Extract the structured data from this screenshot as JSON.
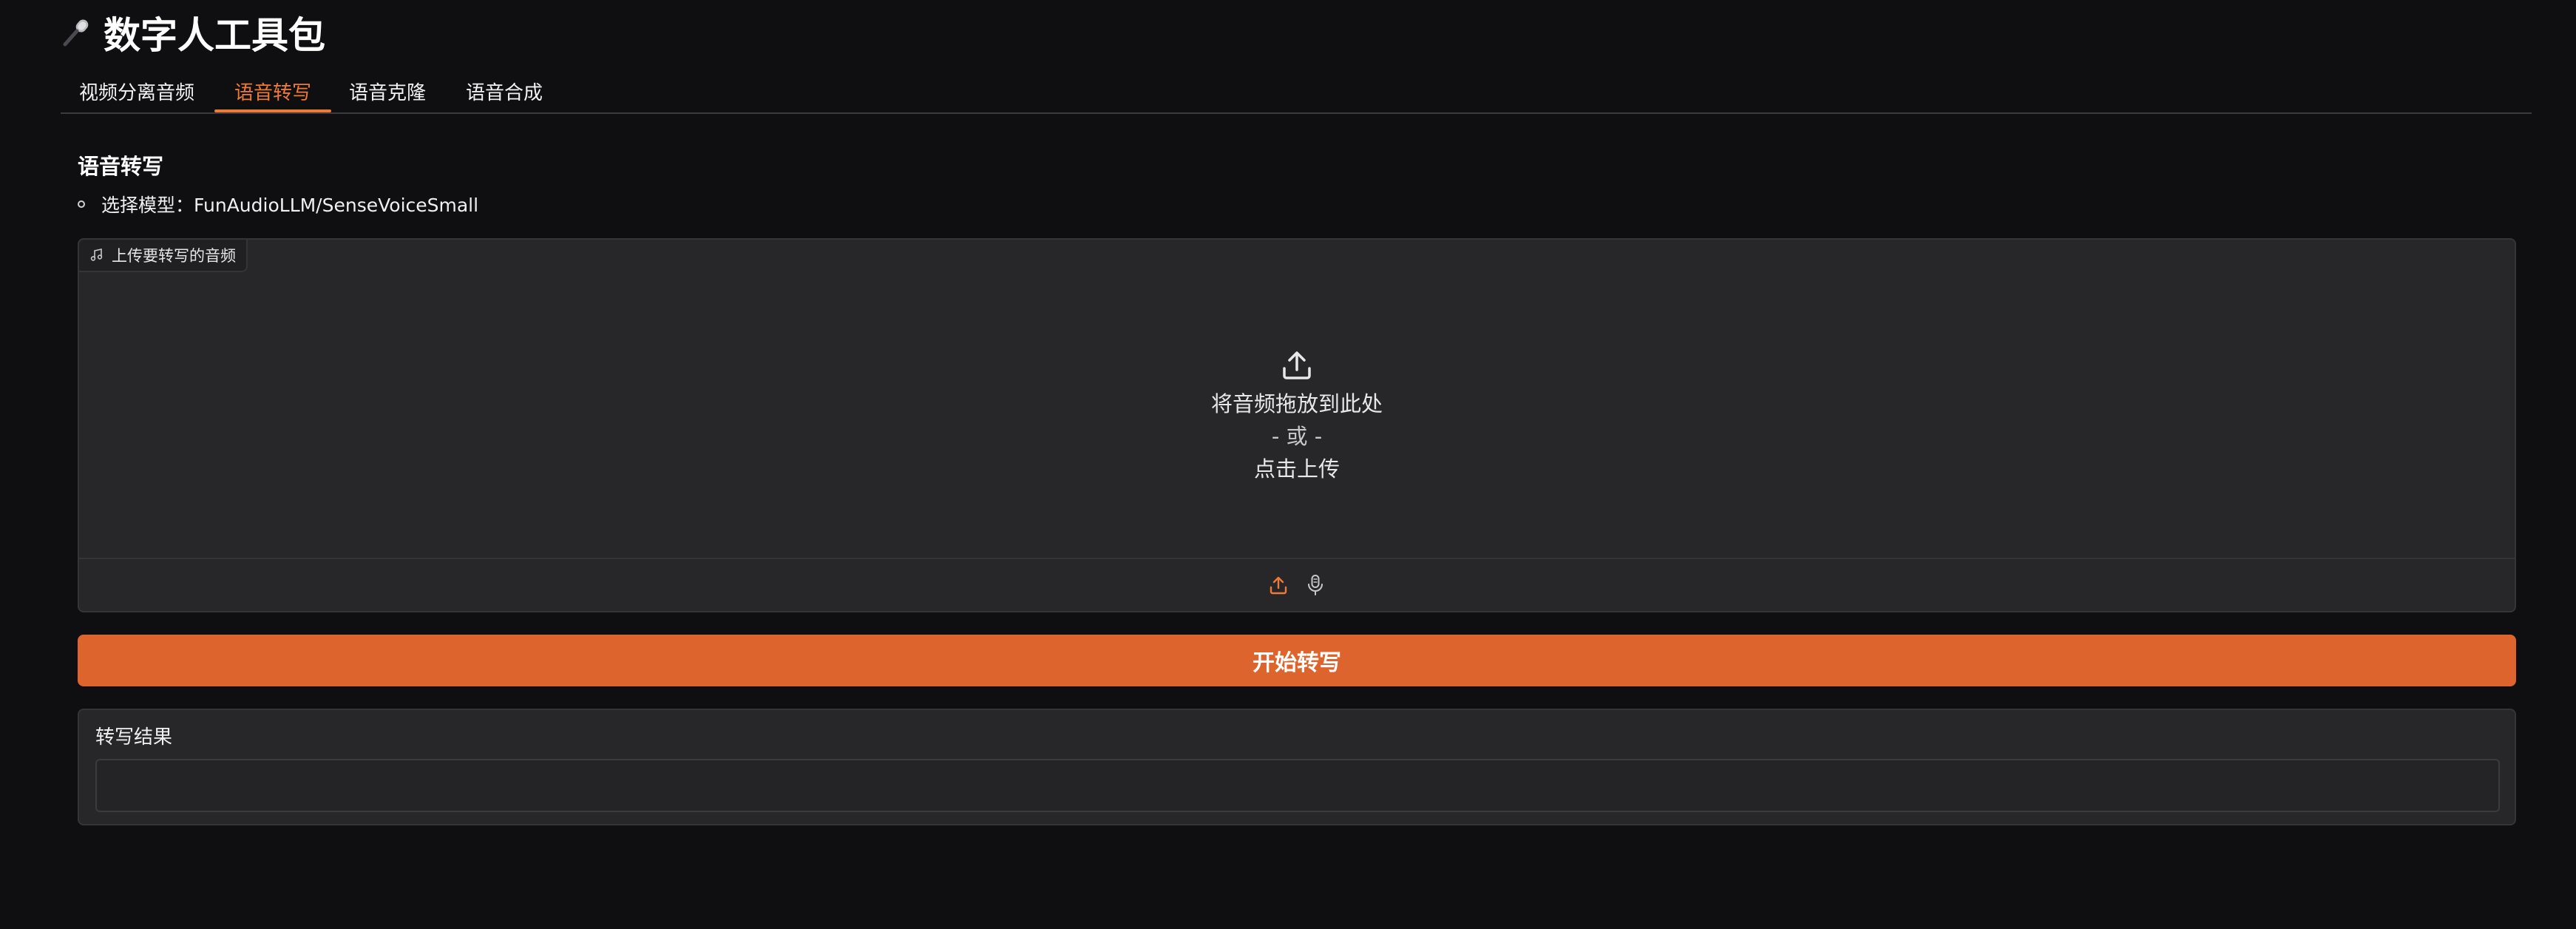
{
  "app": {
    "title": "数字人工具包",
    "title_icon": "microphone-icon"
  },
  "tabs": [
    {
      "label": "视频分离音频",
      "active": false
    },
    {
      "label": "语音转写",
      "active": true
    },
    {
      "label": "语音克隆",
      "active": false
    },
    {
      "label": "语音合成",
      "active": false
    }
  ],
  "section": {
    "title": "语音转写",
    "model_line": "选择模型：FunAudioLLM/SenseVoiceSmall"
  },
  "upload": {
    "label": "上传要转写的音频",
    "label_icon": "music-note-icon",
    "drop_text": "将音频拖放到此处",
    "or_text": "- 或 -",
    "click_text": "点击上传",
    "upload_icon": "upload-icon",
    "source_upload_icon": "upload-source-icon",
    "source_mic_icon": "microphone-source-icon"
  },
  "actions": {
    "start_label": "开始转写"
  },
  "result": {
    "label": "转写结果",
    "value": ""
  },
  "colors": {
    "accent": "#ed7a36",
    "button": "#dd642c",
    "background": "#0f0f11",
    "panel": "#27272a"
  }
}
